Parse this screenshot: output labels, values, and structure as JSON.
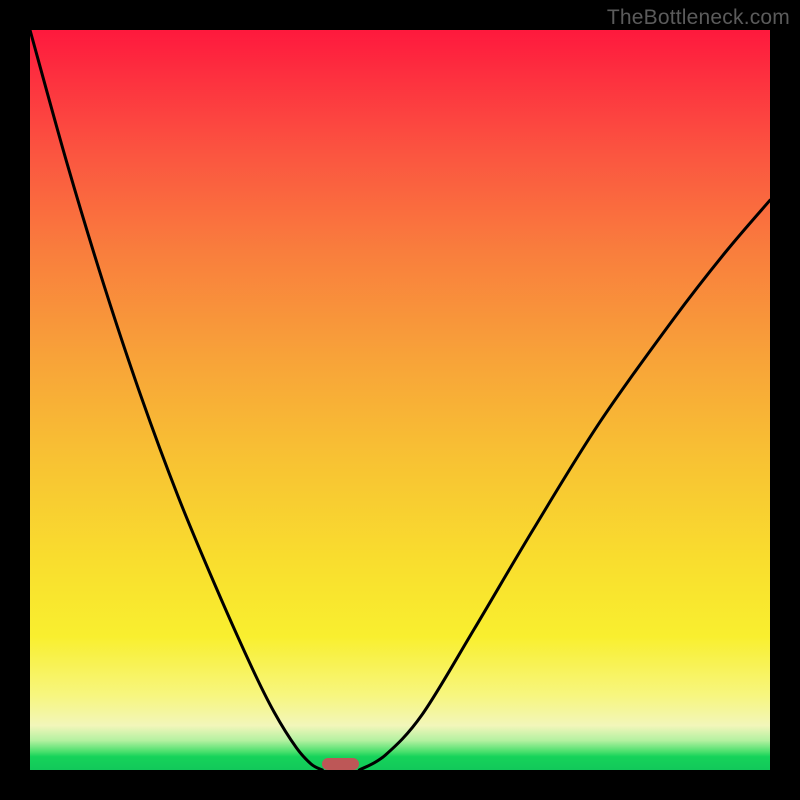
{
  "watermark": "TheBottleneck.com",
  "chart_data": {
    "type": "line",
    "title": "",
    "xlabel": "",
    "ylabel": "",
    "xlim": [
      0,
      1
    ],
    "ylim": [
      0,
      1
    ],
    "grid": false,
    "series": [
      {
        "name": "left-branch",
        "x": [
          0.0,
          0.05,
          0.1,
          0.15,
          0.2,
          0.25,
          0.3,
          0.33,
          0.36,
          0.38,
          0.395
        ],
        "values": [
          1.0,
          0.82,
          0.655,
          0.505,
          0.37,
          0.25,
          0.138,
          0.078,
          0.03,
          0.008,
          0.0
        ]
      },
      {
        "name": "right-branch",
        "x": [
          0.445,
          0.48,
          0.53,
          0.6,
          0.68,
          0.77,
          0.87,
          0.94,
          1.0
        ],
        "values": [
          0.0,
          0.02,
          0.075,
          0.19,
          0.325,
          0.47,
          0.61,
          0.7,
          0.77
        ]
      }
    ],
    "marker": {
      "x_start": 0.395,
      "x_end": 0.445,
      "y": 0.0,
      "color": "#bd5757"
    },
    "background_gradient": {
      "top": "#fe193d",
      "bottom": "#12c85a"
    }
  },
  "layout": {
    "image_size": 800,
    "border": 30,
    "plot_size": 740
  }
}
